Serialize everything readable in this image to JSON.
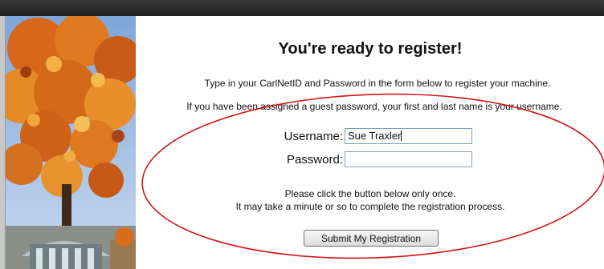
{
  "page": {
    "title": "You're ready to register!",
    "instruction": "Type in your CarlNetID and Password in the form below to register your machine.",
    "guest_note": "If you have been assigned a guest password, your first and last name is your username."
  },
  "form": {
    "username_label": "Username:",
    "username_value": "Sue Traxler",
    "password_label": "Password:",
    "password_value": ""
  },
  "notice": {
    "line1": "Please click the button below only once.",
    "line2": "It may take a minute or so to complete the registration process."
  },
  "submit": {
    "label": "Submit My Registration"
  },
  "annotation": {
    "color": "#d0161a"
  }
}
